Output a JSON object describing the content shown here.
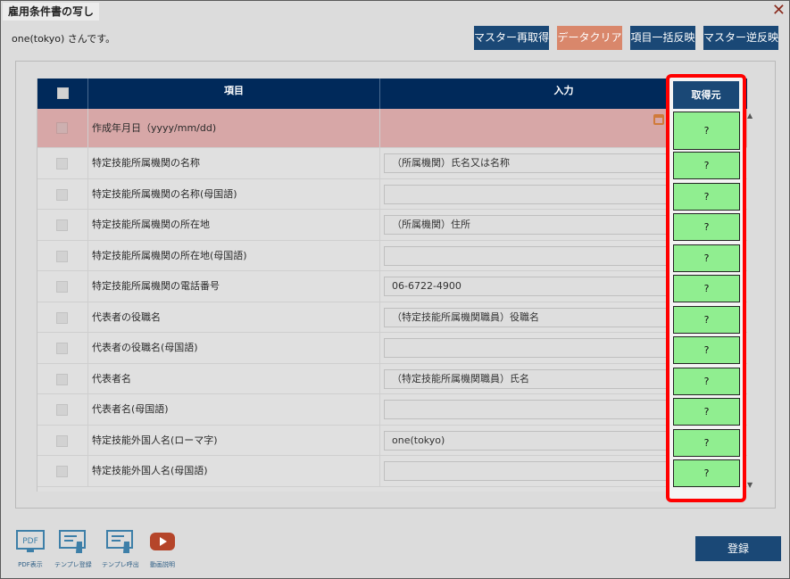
{
  "window": {
    "title": "雇用条件書の写し",
    "close": "✕"
  },
  "user_message": "one(tokyo) さんです。",
  "toolbar": {
    "master_refetch": "マスター再取得",
    "data_clear": "データクリア",
    "item_apply": "項目一括反映",
    "master_reverse": "マスター逆反映"
  },
  "table": {
    "headers": {
      "item": "項目",
      "input": "入力",
      "source": "取得元"
    },
    "rows": [
      {
        "label": "作成年月日（yyyy/mm/dd)",
        "value": "",
        "source": "?"
      },
      {
        "label": "特定技能所属機関の名称",
        "value": "（所属機関）氏名又は名称",
        "source": "?"
      },
      {
        "label": "特定技能所属機関の名称(母国語)",
        "value": "",
        "source": "?"
      },
      {
        "label": "特定技能所属機関の所在地",
        "value": "（所属機関）住所",
        "source": "?"
      },
      {
        "label": "特定技能所属機関の所在地(母国語)",
        "value": "",
        "source": "?"
      },
      {
        "label": "特定技能所属機関の電話番号",
        "value": "06-6722-4900",
        "source": "?"
      },
      {
        "label": "代表者の役職名",
        "value": "（特定技能所属機関職員）役職名",
        "source": "?"
      },
      {
        "label": "代表者の役職名(母国語)",
        "value": "",
        "source": "?"
      },
      {
        "label": "代表者名",
        "value": "（特定技能所属機関職員）氏名",
        "source": "?"
      },
      {
        "label": "代表者名(母国語)",
        "value": "",
        "source": "?"
      },
      {
        "label": "特定技能外国人名(ローマ字)",
        "value": "one(tokyo)",
        "source": "?"
      },
      {
        "label": "特定技能外国人名(母国語)",
        "value": "",
        "source": "?"
      }
    ]
  },
  "bottom_icons": [
    {
      "label": "PDF表示",
      "icon": "pdf-icon",
      "glyph": "PDF"
    },
    {
      "label": "テンプレ登録",
      "icon": "template-register-icon"
    },
    {
      "label": "テンプレ呼出",
      "icon": "template-call-icon"
    },
    {
      "label": "動画説明",
      "icon": "video-icon"
    }
  ],
  "register_button": "登録",
  "colors": {
    "accent": "#1a4876",
    "header": "#00295a",
    "highlight_row": "#d7a7a7",
    "source_cell": "#90ee90",
    "highlight_border": "#ff0000",
    "clear_button": "#d9876b"
  }
}
